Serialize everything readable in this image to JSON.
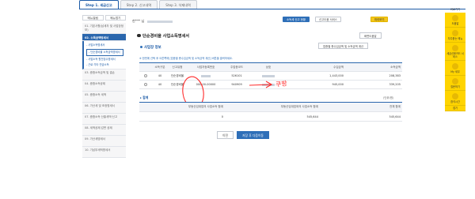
{
  "steps": [
    {
      "label": "Step 1. 세금신고",
      "active": true
    },
    {
      "label": "Step 2. 신고내역",
      "active": false
    },
    {
      "label": "Step 3. 삭제내역",
      "active": false
    }
  ],
  "sidebar": {
    "tabs": [
      "메뉴열림",
      "메뉴접기"
    ],
    "items": [
      {
        "label": "01. 기본사항(납세자 및 사업장정보)",
        "type": "dim"
      },
      {
        "label": "02. 소득금액명세서",
        "type": "active"
      },
      {
        "label": "- 사업소득명세서",
        "type": "sub"
      },
      {
        "label": "- 단순경비율 소득금액명세서",
        "type": "sub-sel"
      },
      {
        "label": "- 사업소득 원천징수명세서",
        "type": "sub"
      },
      {
        "label": "- 근로·기타 연금소득",
        "type": "sub"
      },
      {
        "label": "03. 종합소득금액 및 결손",
        "type": "dim"
      },
      {
        "label": "04. 종합소득공제",
        "type": "dim"
      },
      {
        "label": "05. 종합소득 세액",
        "type": "dim"
      },
      {
        "label": "06. 가산세 및 조정명세서",
        "type": "dim"
      },
      {
        "label": "07. 종합소득 산출세액·신고",
        "type": "dim"
      },
      {
        "label": "08. 세액공제 감면 공제",
        "type": "dim"
      },
      {
        "label": "09. 가산세명세서",
        "type": "dim"
      },
      {
        "label": "10. 기납부세액명세서",
        "type": "dim"
      }
    ]
  },
  "header": {
    "user_label": "한*** 님",
    "btn_report": "소득세 신고 현황",
    "btn_guide": "신고도움 서비스",
    "btn_preview": "미리보기"
  },
  "page": {
    "title": "단순경비율 사업소득명세서",
    "help_button": "화면도움말",
    "section_title": "사업장 정보",
    "btn_apply": "업종별 총수입금액 및 소득금액 계산",
    "notice": "※ 한번에 선택 후 오른쪽에 [업종별 총수입금액 및 소득금액 계산] 버튼을 클릭하세요."
  },
  "table": {
    "headers": [
      "",
      "소득구분",
      "신고유형",
      "사업자등록번호",
      "주업종코드",
      "상호",
      "수입금액",
      "소득금액"
    ],
    "rows": [
      {
        "income_type": "40",
        "filing_type": "단순경비율",
        "reg_no": "",
        "industry_code": "526101",
        "name": "",
        "revenue": "1,443,000",
        "income": "208,383"
      },
      {
        "income_type": "40",
        "filing_type": "단순경비율",
        "reg_no": "000-00-00000",
        "industry_code": "940909",
        "name": "",
        "revenue": "945,000",
        "income": "339,205"
      }
    ]
  },
  "annotation": {
    "text": "쿠팡"
  },
  "totals": {
    "label": "▸ 합계",
    "unit": "(단위:원)",
    "headers": [
      "부동산임대업의 사업소득 합계",
      "부동산임대업외의 사업소득 합계",
      "전체 합계"
    ],
    "values": [
      "0",
      "545,644",
      "545,644"
    ]
  },
  "buttons": {
    "prev": "이전",
    "save": "저장 후 다음이동"
  },
  "rail": {
    "top": "바로가기",
    "items": [
      "도움말",
      "자주묻는 메뉴",
      "세금신용카드 서비스",
      "My 세무",
      "질문하기",
      "참석시간",
      "접기"
    ]
  }
}
